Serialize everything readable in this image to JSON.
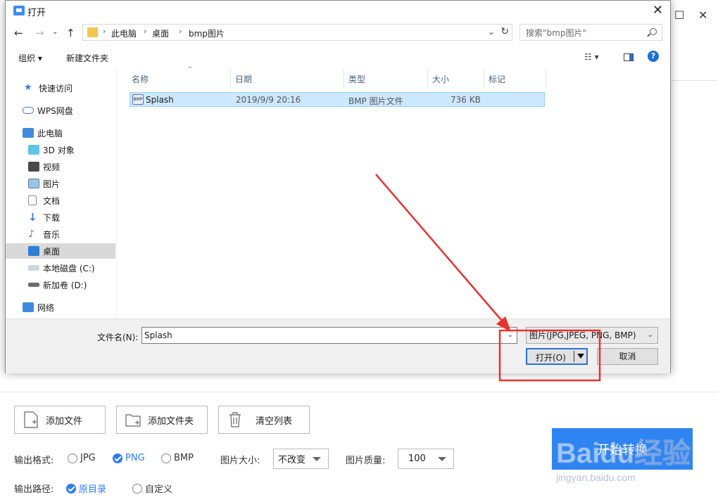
{
  "dialog": {
    "title": "打开",
    "breadcrumbs": [
      "此电脑",
      "桌面",
      "bmp图片"
    ],
    "search_placeholder": "搜索\"bmp图片\"",
    "toolbar": {
      "organize": "组织 ▾",
      "new_folder": "新建文件夹"
    },
    "sidebar": [
      {
        "label": "快速访问",
        "icon": "star-icon"
      },
      {
        "label": "WPS网盘",
        "icon": "cloud-icon"
      },
      {
        "label": "此电脑",
        "icon": "computer-icon"
      },
      {
        "label": "3D 对象",
        "icon": "cube-icon"
      },
      {
        "label": "视频",
        "icon": "video-icon"
      },
      {
        "label": "图片",
        "icon": "picture-icon"
      },
      {
        "label": "文档",
        "icon": "document-icon"
      },
      {
        "label": "下载",
        "icon": "download-icon"
      },
      {
        "label": "音乐",
        "icon": "music-icon"
      },
      {
        "label": "桌面",
        "icon": "desktop-icon",
        "selected": true
      },
      {
        "label": "本地磁盘 (C:)",
        "icon": "drive-icon"
      },
      {
        "label": "新加卷 (D:)",
        "icon": "drive-icon"
      },
      {
        "label": "网络",
        "icon": "network-icon"
      }
    ],
    "columns": [
      "名称",
      "日期",
      "类型",
      "大小",
      "标记"
    ],
    "files": [
      {
        "name": "Splash",
        "date": "2019/9/9 20:16",
        "type": "BMP 图片文件",
        "size": "736 KB",
        "icon_text": "BMP"
      }
    ],
    "filename_label": "文件名(N):",
    "filename_value": "Splash",
    "filetype_value": "图片(JPG,JPEG, PNG, BMP)",
    "open_button": "打开(O)",
    "cancel_button": "取消"
  },
  "app": {
    "buttons": {
      "add_file": "添加文件",
      "add_folder": "添加文件夹",
      "clear_list": "清空列表"
    },
    "output_format_label": "输出格式:",
    "formats": [
      {
        "label": "JPG",
        "checked": false
      },
      {
        "label": "PNG",
        "checked": true
      },
      {
        "label": "BMP",
        "checked": false
      }
    ],
    "image_size_label": "图片大小:",
    "image_size_value": "不改变",
    "quality_label": "图片质量:",
    "quality_value": "100",
    "output_path_label": "输出路径:",
    "paths": [
      {
        "label": "原目录",
        "checked": true
      },
      {
        "label": "自定义",
        "checked": false
      }
    ],
    "start_button": "开始转换",
    "accent_color": "#2e84f2"
  },
  "watermark": {
    "logo": "Baidu经验",
    "url": "jingyan.baidu.com"
  }
}
